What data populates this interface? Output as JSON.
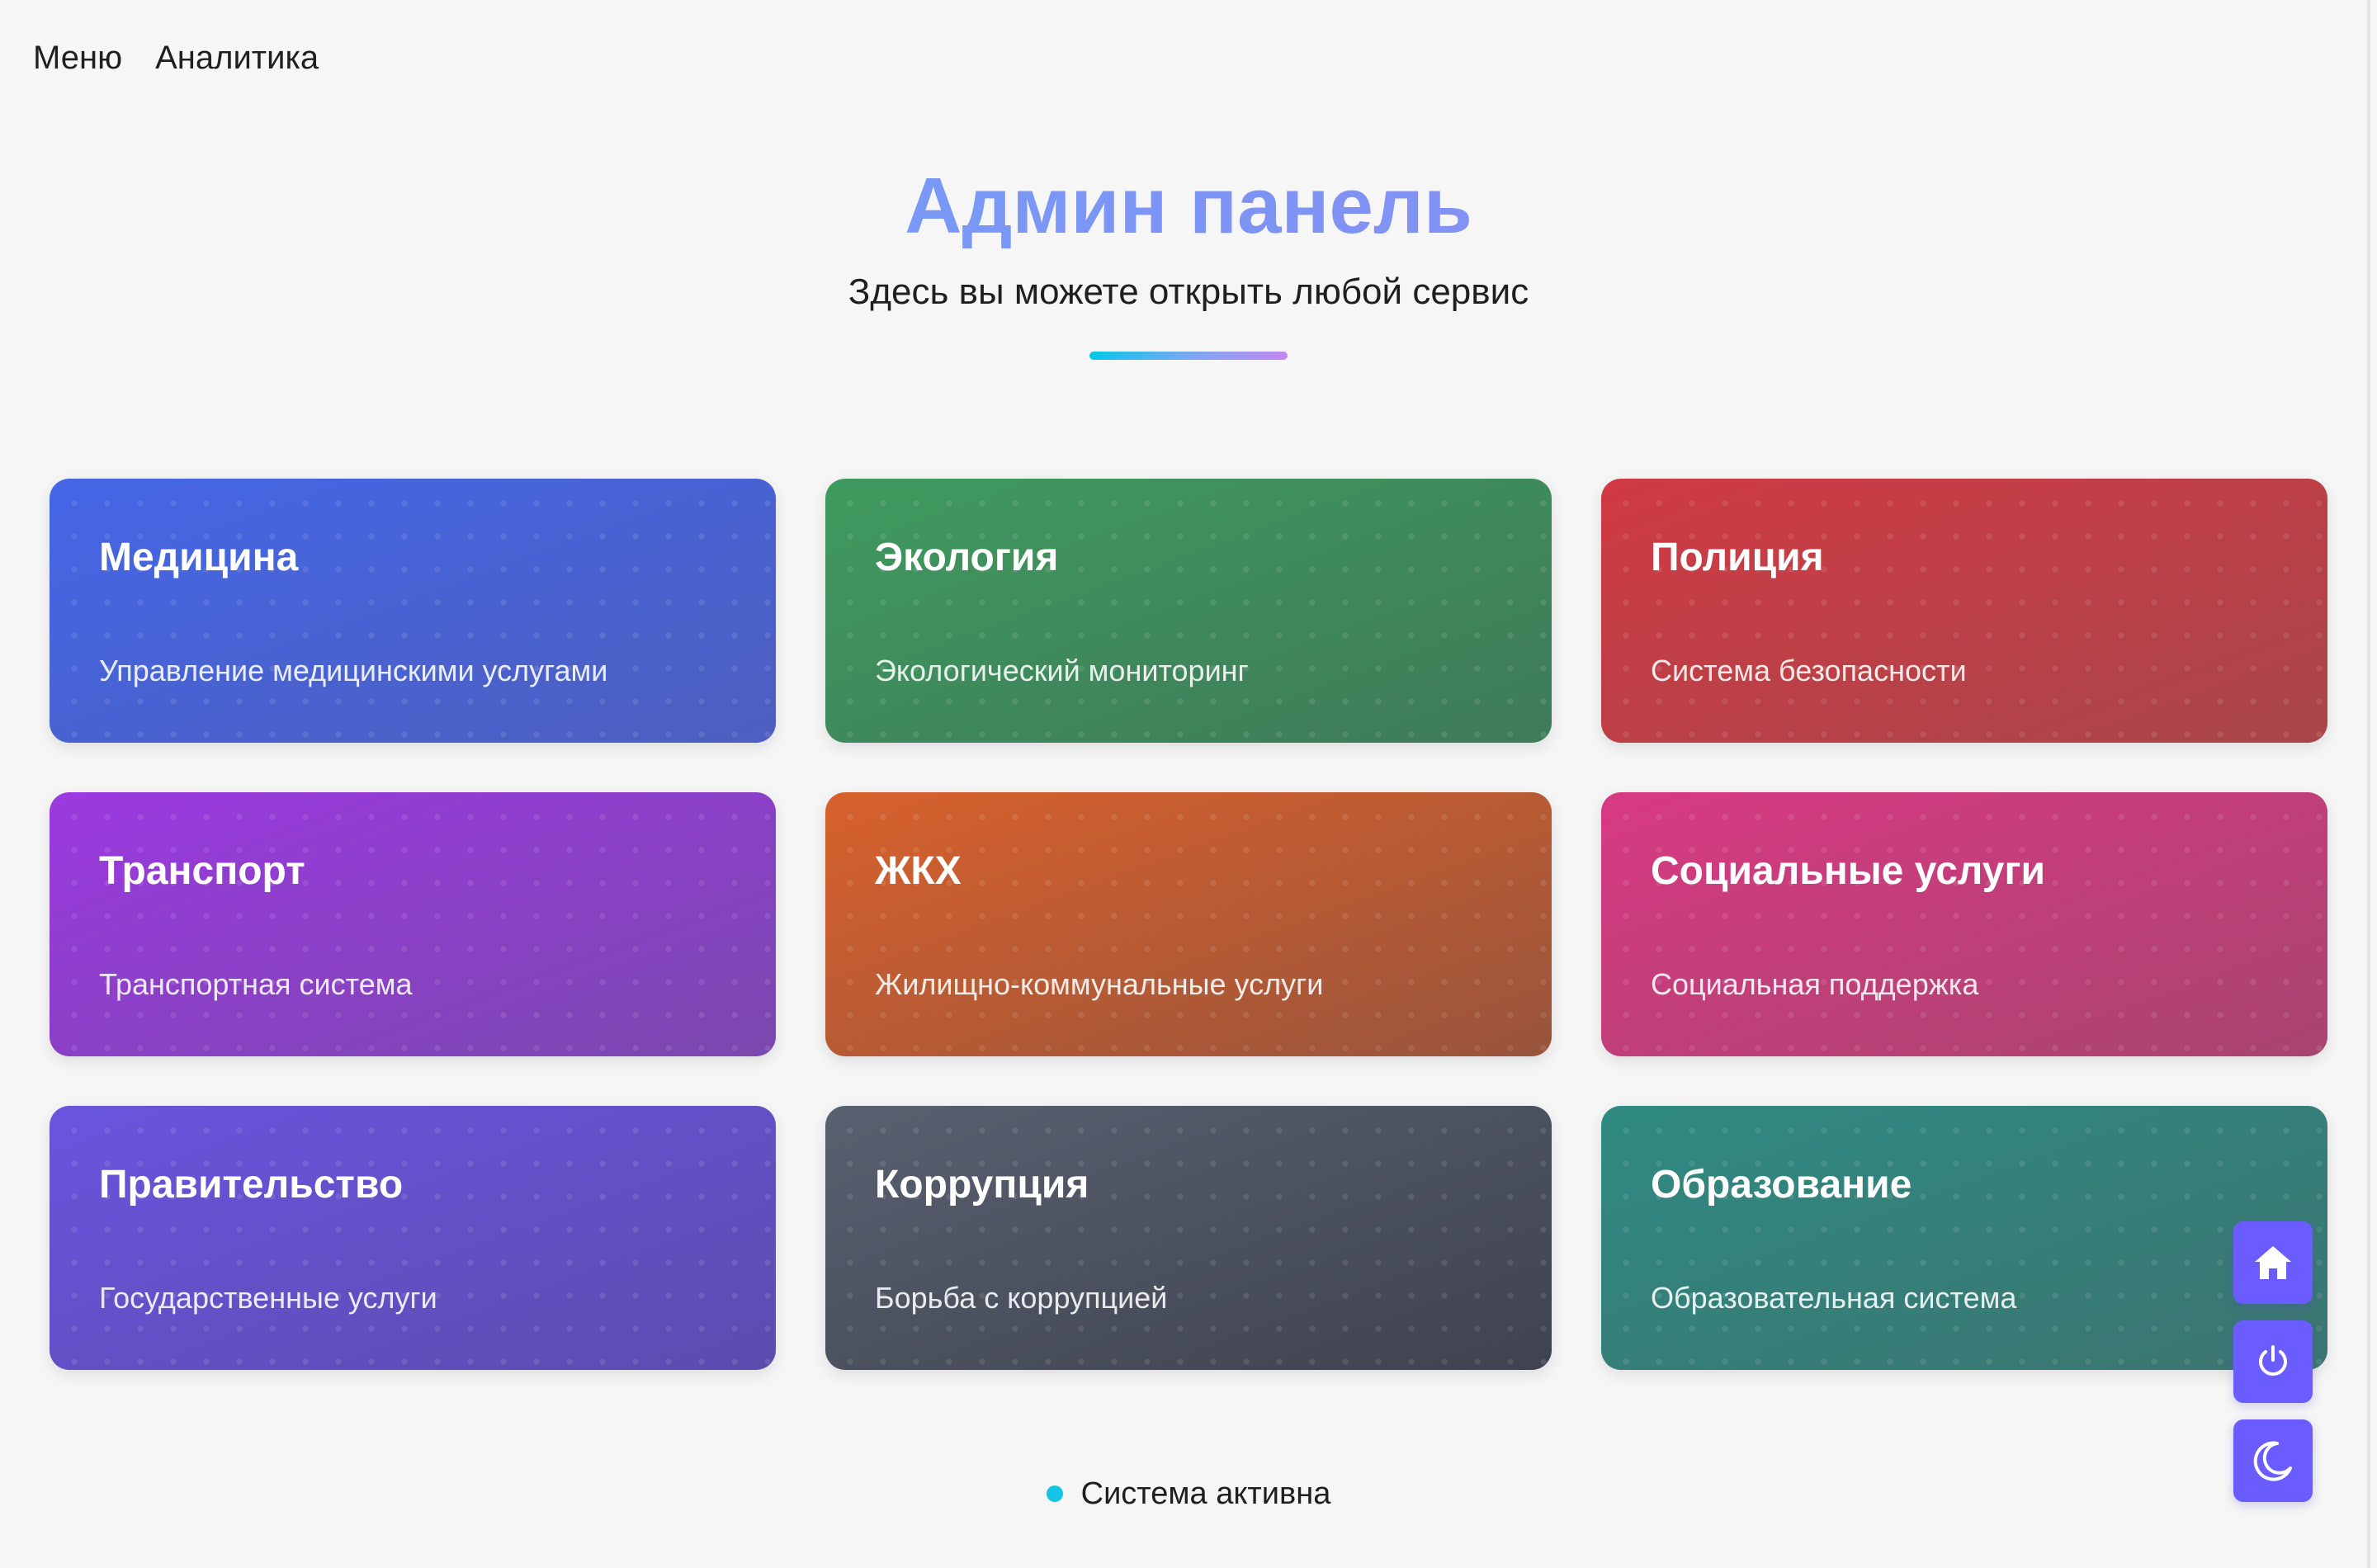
{
  "nav": {
    "items": [
      {
        "label": "Меню"
      },
      {
        "label": "Аналитика"
      }
    ]
  },
  "hero": {
    "title": "Админ панель",
    "subtitle": "Здесь вы можете открыть любой сервис"
  },
  "services": [
    {
      "title": "Медицина",
      "description": "Управление медицинскими услугами",
      "color": "#4466e6"
    },
    {
      "title": "Экология",
      "description": "Экологический мониторинг",
      "color": "#3f9a5e"
    },
    {
      "title": "Полиция",
      "description": "Система безопасности",
      "color": "#d03a44"
    },
    {
      "title": "Транспорт",
      "description": "Транспортная система",
      "color": "#9b39e0"
    },
    {
      "title": "ЖКХ",
      "description": "Жилищно-коммунальные услуги",
      "color": "#d8612c"
    },
    {
      "title": "Социальные услуги",
      "description": "Социальная поддержка",
      "color": "#d83a82"
    },
    {
      "title": "Правительство",
      "description": "Государственные услуги",
      "color": "#6a54de"
    },
    {
      "title": "Коррупция",
      "description": "Борьба с коррупцией",
      "color": "#59606f"
    },
    {
      "title": "Образование",
      "description": "Образовательная система",
      "color": "#2f8a82"
    }
  ],
  "status": {
    "label": "Система активна",
    "color": "#14c4e4"
  },
  "fab": {
    "accent": "#6a5cff",
    "icons": [
      "home-icon",
      "power-icon",
      "moon-icon"
    ]
  }
}
